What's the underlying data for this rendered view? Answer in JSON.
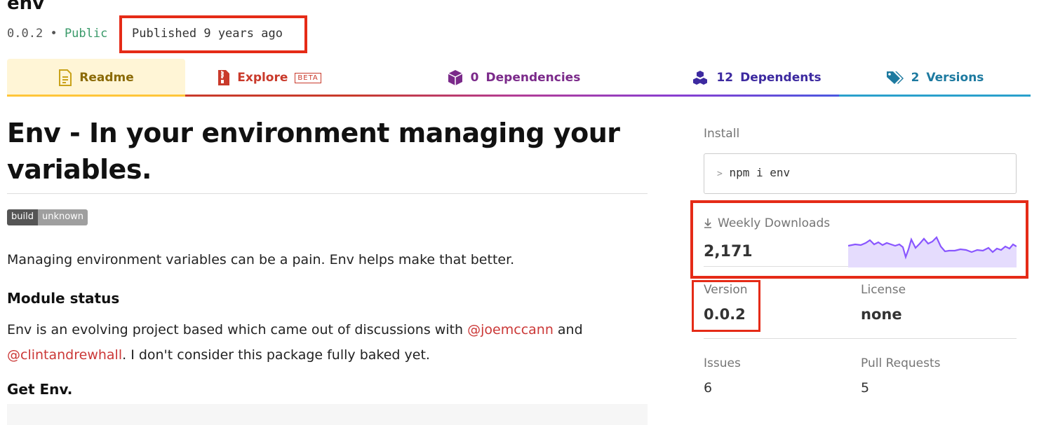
{
  "package": {
    "name": "env",
    "version": "0.0.2",
    "separator": "•",
    "visibility": "Public",
    "published": "Published 9 years ago"
  },
  "tabs": [
    {
      "label": "Readme",
      "icon": "readme-doc-icon"
    },
    {
      "label": "Explore",
      "badge": "BETA",
      "icon": "zip-file-icon"
    },
    {
      "count": "0",
      "label": "Dependencies",
      "icon": "box-icon"
    },
    {
      "count": "12",
      "label": "Dependents",
      "icon": "boxes-icon"
    },
    {
      "count": "2",
      "label": "Versions",
      "icon": "tags-icon"
    }
  ],
  "readme": {
    "title": "Env - In your environment managing your variables.",
    "badge_left": "build",
    "badge_right": "unknown",
    "intro": "Managing environment variables can be a pain. Env helps make that better.",
    "status_heading": "Module status",
    "status_text_1": "Env is an evolving project based which came out of discussions with ",
    "mention_1": "@joemccann",
    "status_text_2": " and ",
    "mention_2": "@clintandrewhall",
    "status_text_3": ". I don't consider this package fully baked yet.",
    "get_heading": "Get Env."
  },
  "sidebar": {
    "install_label": "Install",
    "install_prompt": ">",
    "install_command": "npm i env",
    "downloads_label": "Weekly Downloads",
    "downloads_count": "2,171",
    "version_label": "Version",
    "version_value": "0.0.2",
    "license_label": "License",
    "license_value": "none",
    "issues_label": "Issues",
    "issues_value": "6",
    "prs_label": "Pull Requests",
    "prs_value": "5"
  },
  "colors": {
    "npm_red": "#cb3837",
    "highlight_box": "#e52b17",
    "sparkline": "#8956ff"
  }
}
